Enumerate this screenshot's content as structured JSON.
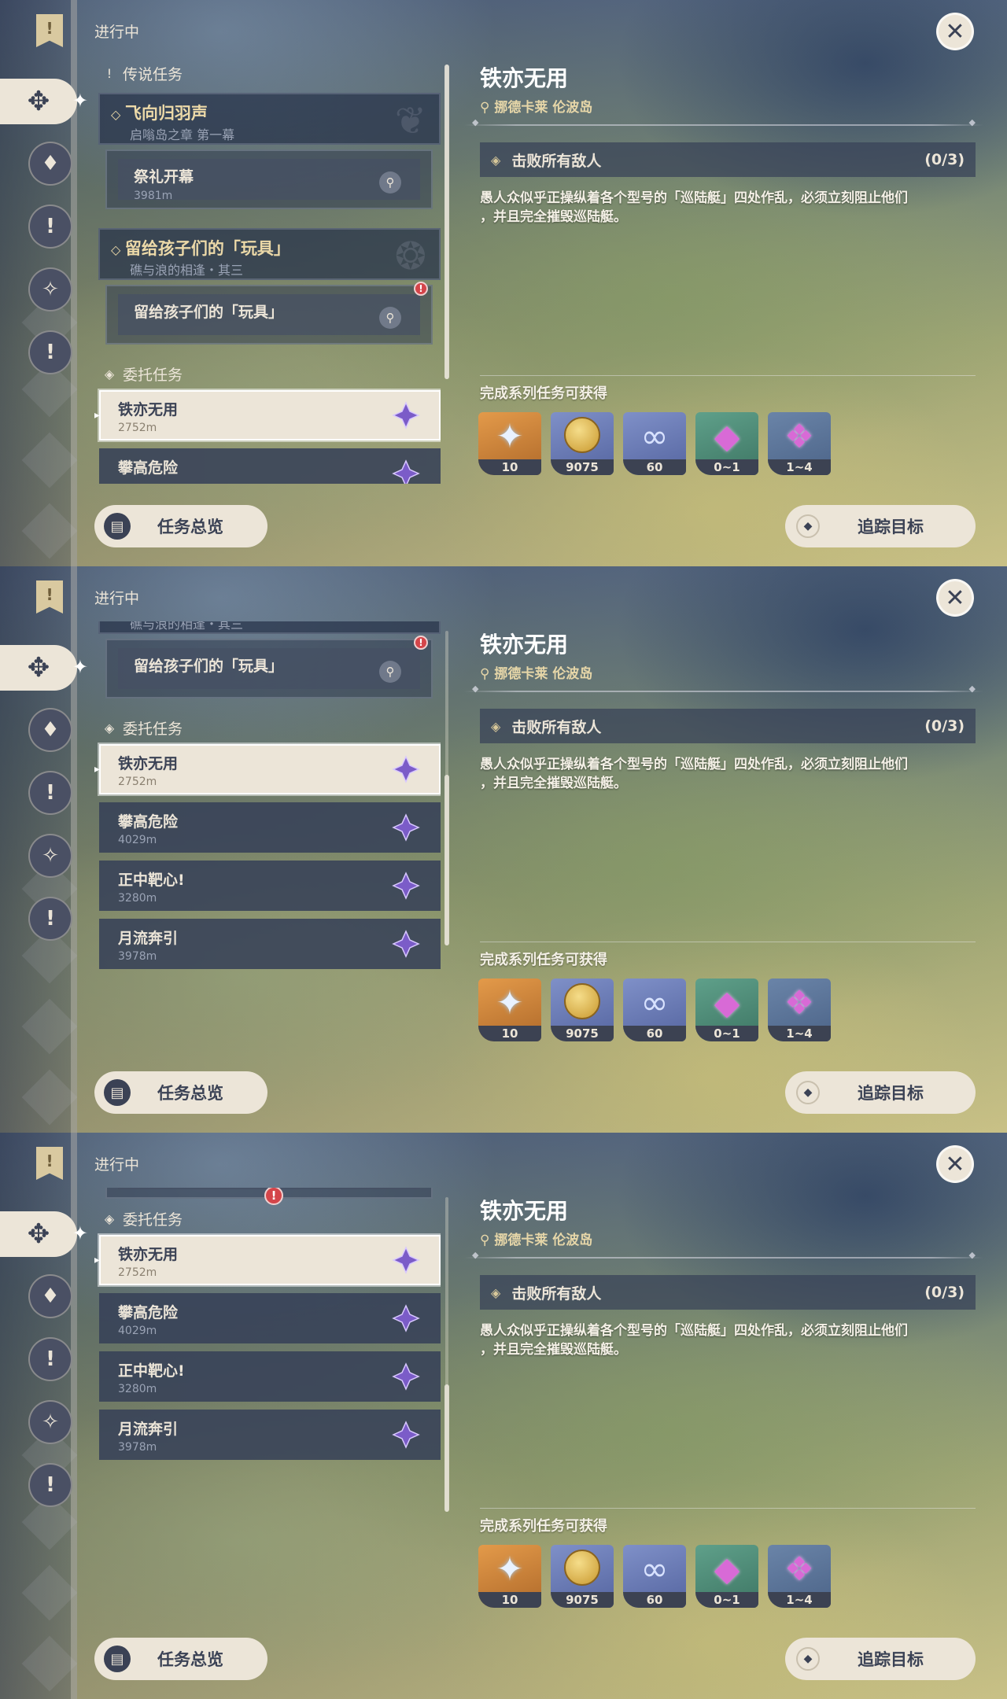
{
  "in_progress_label": "进行中",
  "sections": {
    "legend": "传说任务",
    "commission": "委托任务"
  },
  "legend_quests": [
    {
      "title": "飞向归羽声",
      "subtitle": "启嗡岛之章 第一幕",
      "sub": {
        "title": "祭礼开幕",
        "distance": "3981m"
      }
    },
    {
      "title": "留给孩子们的「玩具」",
      "subtitle": "礁与浪的相逢・其三",
      "sub": {
        "title": "留给孩子们的「玩具」",
        "distance": ""
      }
    }
  ],
  "commissions": [
    {
      "title": "铁亦无用",
      "distance": "2752m"
    },
    {
      "title": "攀高危险",
      "distance": "4029m"
    },
    {
      "title": "正中靶心!",
      "distance": "3280m"
    },
    {
      "title": "月流奔引",
      "distance": "3978m"
    }
  ],
  "detail": {
    "title": "铁亦无用",
    "location": "挪德卡莱 伦波岛",
    "objective": "击败所有敌人",
    "objective_count": "(0/3)",
    "description_line1": "愚人众似乎正操纵着各个型号的「巡陆艇」四处作乱，必须立刻阻止他们",
    "description_line2": "，并且完全摧毁巡陆艇。",
    "rewards_label": "完成系列任务可获得",
    "rewards": [
      {
        "icon": "primogem-icon",
        "count": "10"
      },
      {
        "icon": "mora-icon",
        "count": "9075"
      },
      {
        "icon": "adventure-exp-icon",
        "count": "60"
      },
      {
        "icon": "crystal-green-icon",
        "count": "0~1"
      },
      {
        "icon": "crystal-pink-icon",
        "count": "1~4"
      }
    ]
  },
  "buttons": {
    "overview": "任务总览",
    "track": "追踪目标"
  }
}
